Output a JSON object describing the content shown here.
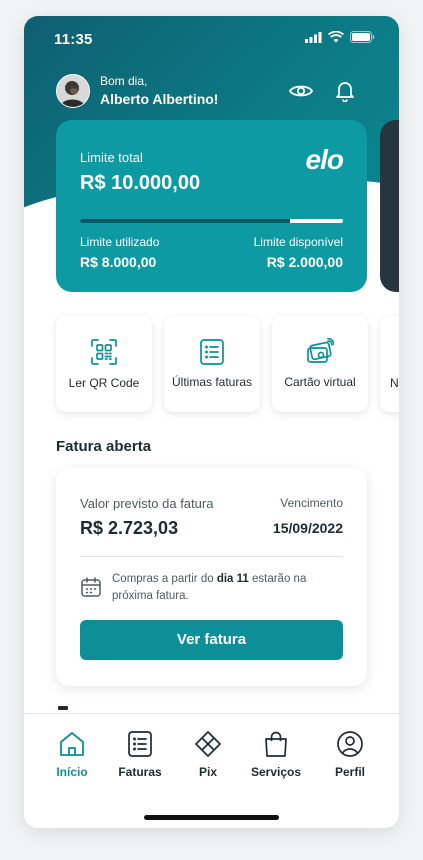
{
  "status": {
    "time": "11:35"
  },
  "header": {
    "greeting": "Bom dia,",
    "name": "Alberto Albertino!"
  },
  "card": {
    "brand": "elo",
    "limit_label": "Limite total",
    "limit_value": "R$ 10.000,00",
    "used_fraction": 0.8,
    "used_label": "Limite utilizado",
    "used_value": "R$ 8.000,00",
    "available_label": "Limite disponível",
    "available_value": "R$ 2.000,00"
  },
  "actions": [
    {
      "label": "Ler QR Code",
      "icon": "qr-scan-icon"
    },
    {
      "label": "Últimas faturas",
      "icon": "list-icon"
    },
    {
      "label": "Cartão virtual",
      "icon": "virtual-card-icon"
    },
    {
      "label": "N",
      "icon": "partial"
    }
  ],
  "invoice": {
    "section_title": "Fatura aberta",
    "estimate_label": "Valor previsto da fatura",
    "estimate_value": "R$ 2.723,03",
    "due_label": "Vencimento",
    "due_value": "15/09/2022",
    "note_pre": "Compras a partir do ",
    "note_bold": "dia 11",
    "note_post": " estarão na próxima fatura.",
    "button_label": "Ver fatura"
  },
  "tabs": [
    {
      "label": "Início",
      "icon": "home-icon",
      "active": true
    },
    {
      "label": "Faturas",
      "icon": "invoices-icon",
      "active": false
    },
    {
      "label": "Pix",
      "icon": "pix-icon",
      "active": false
    },
    {
      "label": "Serviços",
      "icon": "shopping-bag-icon",
      "active": false
    },
    {
      "label": "Perfil",
      "icon": "profile-icon",
      "active": false
    }
  ],
  "colors": {
    "accent": "#0e8f98",
    "card": "#0e9aa3",
    "hero": "#0c7d88"
  }
}
